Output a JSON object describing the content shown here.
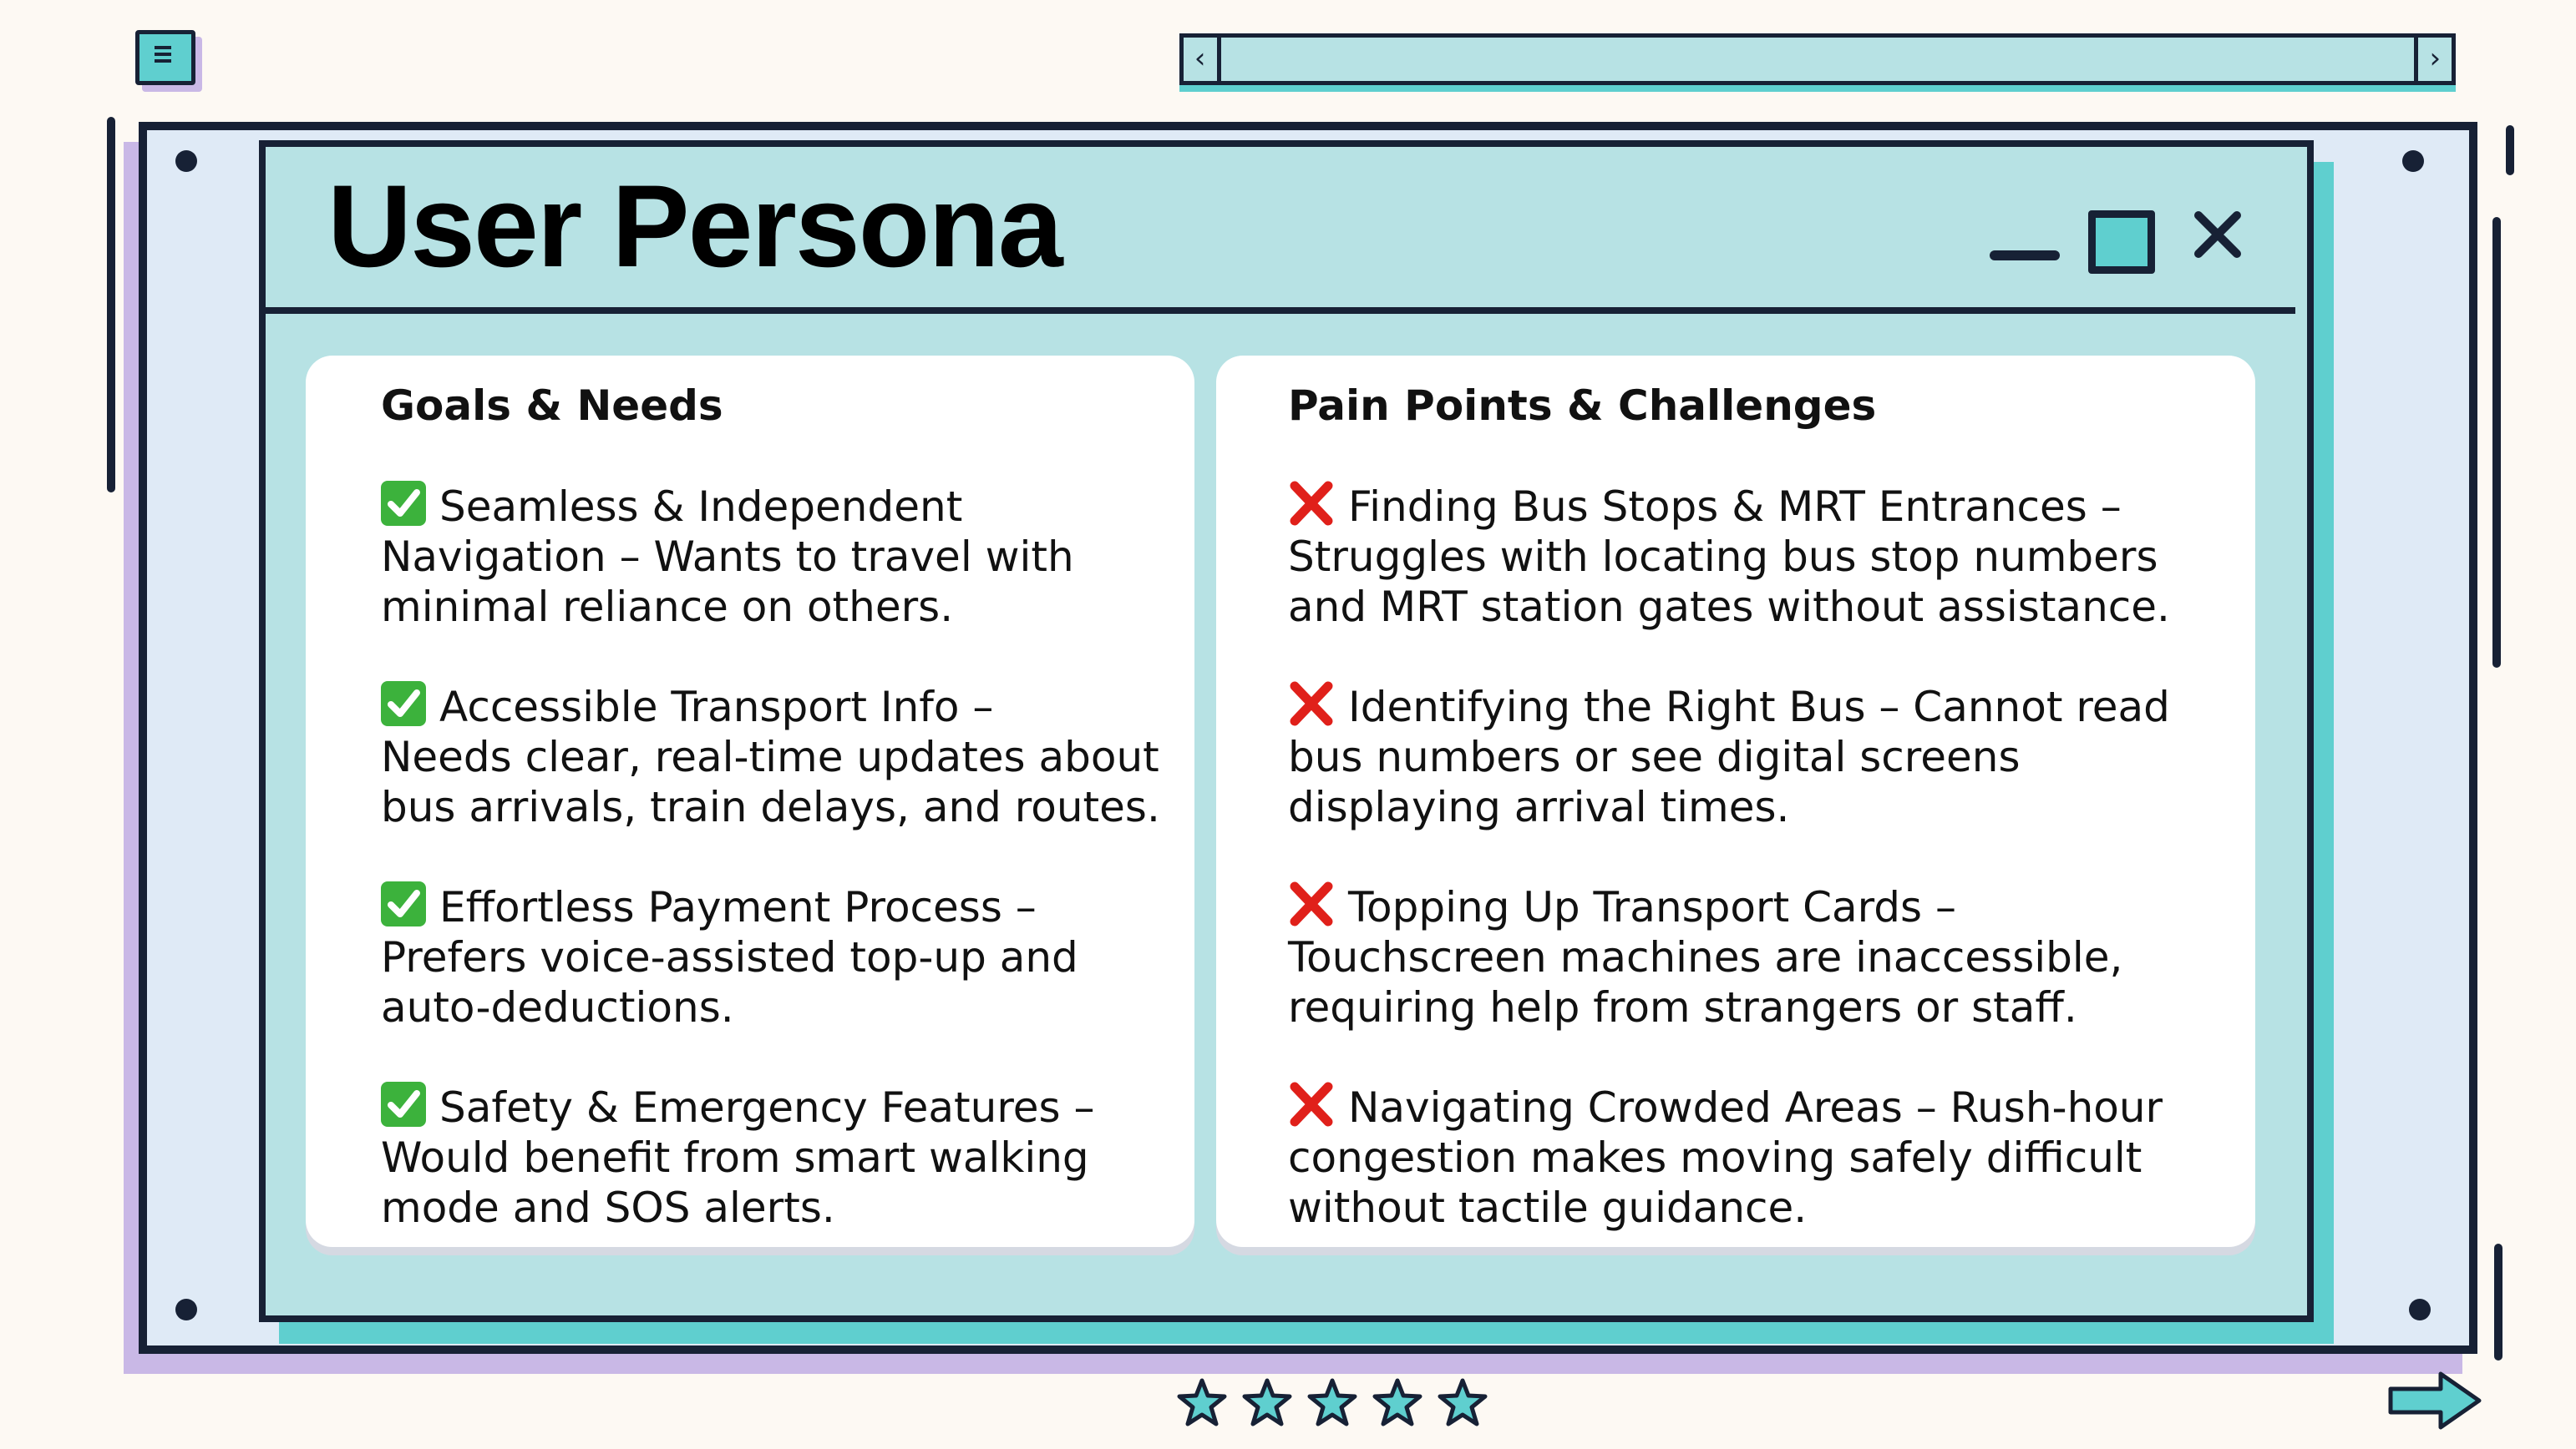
{
  "window": {
    "title": "User Persona"
  },
  "goals": {
    "heading": "Goals & Needs",
    "items": [
      {
        "lines": [
          "Seamless & Independent",
          "Navigation – Wants to travel with",
          "minimal reliance on others."
        ]
      },
      {
        "lines": [
          "Accessible Transport Info –",
          "Needs clear, real-time updates about",
          "bus arrivals, train delays, and routes."
        ]
      },
      {
        "lines": [
          "Effortless Payment Process –",
          "Prefers voice-assisted top-up and",
          "auto-deductions."
        ]
      },
      {
        "lines": [
          "Safety & Emergency Features –",
          "Would benefit from smart walking",
          "mode and SOS alerts."
        ]
      }
    ]
  },
  "pains": {
    "heading": "Pain Points & Challenges",
    "items": [
      {
        "lines": [
          "Finding Bus Stops & MRT Entrances –",
          "Struggles with locating bus stop numbers",
          "and MRT station gates without assistance."
        ]
      },
      {
        "lines": [
          "Identifying the Right Bus – Cannot read",
          "bus numbers or see digital screens",
          "displaying arrival times."
        ]
      },
      {
        "lines": [
          "Topping Up Transport Cards –",
          "Touchscreen machines are inaccessible,",
          "requiring help from strangers or staff."
        ]
      },
      {
        "lines": [
          "Navigating Crowded Areas – Rush-hour",
          "congestion makes moving safely difficult",
          "without tactile guidance."
        ]
      }
    ]
  },
  "icons": {
    "goal_marker": "check-mark-icon",
    "pain_marker": "cross-mark-icon",
    "window_controls": [
      "minimize-icon",
      "maximize-icon",
      "close-icon"
    ],
    "footer": [
      "star-icon",
      "star-icon",
      "star-icon",
      "star-icon",
      "star-icon",
      "next-arrow-icon"
    ]
  },
  "colors": {
    "background": "#fdf9f3",
    "ink": "#172135",
    "teal": "#5fcfcf",
    "pale_teal": "#b7e2e4",
    "lavender": "#c9b8e6",
    "check_green": "#3cb23c",
    "cross_red": "#e0201a"
  }
}
